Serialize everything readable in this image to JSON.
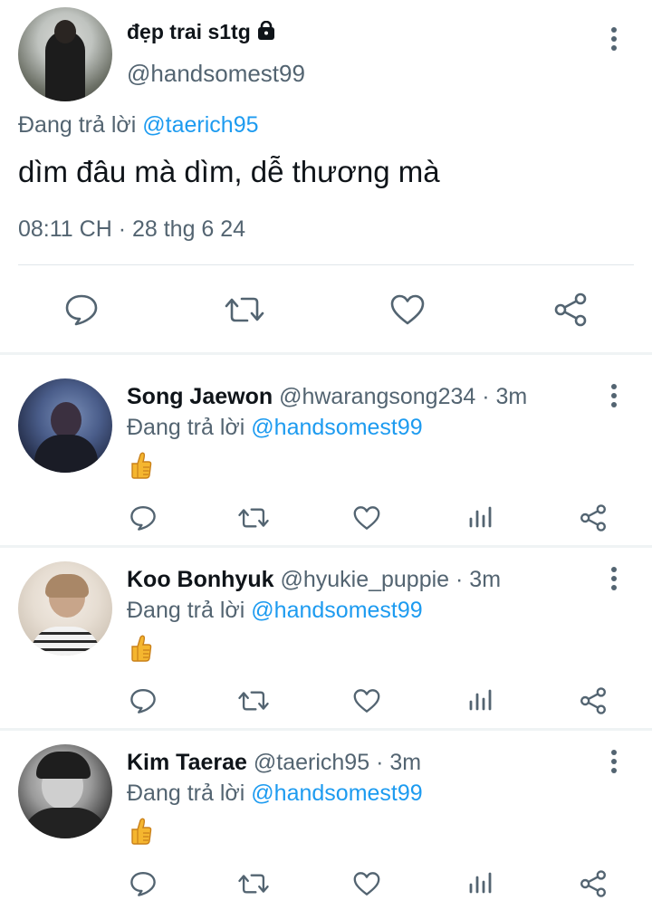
{
  "main_tweet": {
    "display_name": "đẹp trai s1tg",
    "handle": "@handsomest99",
    "reply_prefix": "Đang trả lời",
    "reply_mention": "@taerich95",
    "text": "dìm đâu mà dìm, dễ thương mà",
    "timestamp": "08:11 CH · 28 thg 6 24"
  },
  "replies": [
    {
      "display_name": "Song Jaewon",
      "handle": "@hwarangsong234",
      "time": "· 3m",
      "reply_prefix": "Đang trả lời",
      "reply_mention": "@handsomest99",
      "emoji_icon": "thumbs-up-icon"
    },
    {
      "display_name": "Koo Bonhyuk",
      "handle": "@hyukie_puppie",
      "time": "· 3m",
      "reply_prefix": "Đang trả lời",
      "reply_mention": "@handsomest99",
      "emoji_icon": "thumbs-up-icon"
    },
    {
      "display_name": "Kim Taerae",
      "handle": "@taerich95",
      "time": "· 3m",
      "reply_prefix": "Đang trả lời",
      "reply_mention": "@handsomest99",
      "emoji_icon": "thumbs-up-icon"
    }
  ],
  "colors": {
    "text": "#0f1419",
    "secondary": "#536471",
    "mention": "#1d9bf0",
    "divider": "#eff3f4"
  }
}
